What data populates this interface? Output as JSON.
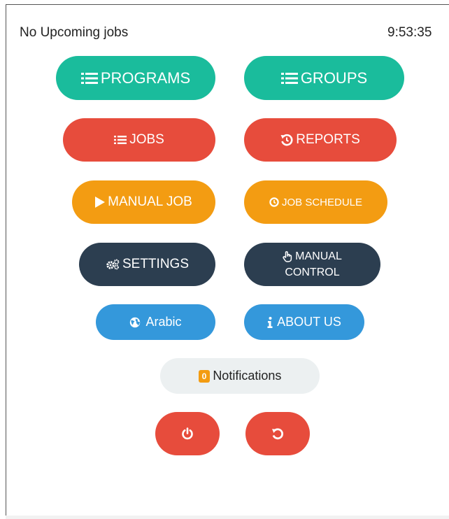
{
  "header": {
    "status_text": "No Upcoming jobs",
    "clock": "9:53:35"
  },
  "buttons": {
    "programs": "PROGRAMS",
    "groups": "GROUPS",
    "jobs": "JOBS",
    "reports": "REPORTS",
    "manual_job": "MANUAL JOB",
    "job_schedule": "JOB SCHEDULE",
    "settings": "SETTINGS",
    "manual_control_line1": "MANUAL",
    "manual_control_line2": "CONTROL",
    "language": "Arabic",
    "about_us": "ABOUT US"
  },
  "notifications": {
    "count": "0",
    "label": "Notifications"
  },
  "icons": {
    "programs": "list-icon",
    "groups": "list-icon",
    "jobs": "list-icon",
    "reports": "history-icon",
    "manual_job": "play-icon",
    "job_schedule": "clock-icon",
    "settings": "cogs-icon",
    "manual_control": "hand-pointer-icon",
    "language": "globe-icon",
    "about_us": "info-icon",
    "power": "power-icon",
    "restart": "restart-icon"
  },
  "colors": {
    "teal": "#1abc9c",
    "red": "#e74c3c",
    "orange": "#f39c12",
    "navy": "#2c3e50",
    "blue": "#3498db",
    "light": "#ecf0f1"
  }
}
